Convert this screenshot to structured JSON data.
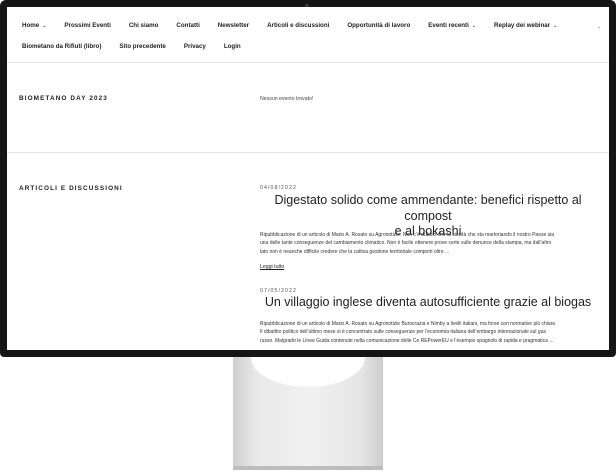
{
  "nav": {
    "row1": [
      {
        "label": "Home",
        "has_dropdown": true
      },
      {
        "label": "Prossimi Eventi",
        "has_dropdown": false
      },
      {
        "label": "Chi siamo",
        "has_dropdown": false
      },
      {
        "label": "Contatti",
        "has_dropdown": false
      },
      {
        "label": "Newsletter",
        "has_dropdown": false
      },
      {
        "label": "Articoli e discussioni",
        "has_dropdown": false
      },
      {
        "label": "Opportunità di lavoro",
        "has_dropdown": false
      },
      {
        "label": "Eventi recenti",
        "has_dropdown": true
      },
      {
        "label": "Replay dei webinar",
        "has_dropdown": true
      }
    ],
    "row2": [
      {
        "label": "Biometano da Rifiuti (libro)"
      },
      {
        "label": "Sito precedente"
      },
      {
        "label": "Privacy"
      },
      {
        "label": "Login"
      }
    ],
    "chevron_glyph": "⌄",
    "overflow_chevron_icon": "chevron-down-icon"
  },
  "event_section": {
    "title": "BIOMETANO DAY 2023",
    "empty_message": "Nessun evento trovato!"
  },
  "articles_section": {
    "title": "ARTICOLI E DISCUSSIONI",
    "posts": [
      {
        "date": "04/08/2022",
        "title_line1": "Digestato solido come ammendante: benefici rispetto al compost",
        "title_line2": "e al bokashi",
        "excerpt_lines": [
          "Ripubblicazione di un articolo di Mario A. Rosato su Agronotizie. Non c’è dubbio che la siccità che sta martoriando il nostro Paese sia",
          "una delle tante conseguenze del cambiamento climatico. Non è facile ottenere prove certe sulle denunce della stampa, ma dall’altro",
          "lato non è neanche difficile credere che la cattiva gestione territoriale comporti oltre ..."
        ],
        "read_more": "Leggi tutto"
      },
      {
        "date": "07/05/2022",
        "title_line1": "Un villaggio inglese diventa autosufficiente grazie al biogas",
        "excerpt_lines": [
          "Ripubblicazione di un articolo di Mario A. Rosato su Agronotizie Burocrazia e Nimby a livelli italiani, ma forse con normative più chiare.",
          "Il dibattito politico dell’ultimo mese si è concentrato sulle conseguenze per l’economia italiana dell’embargo internazionale sul gas",
          "russo. Malgrado le Linee Guida contenute nella comunicazione delle Ce REPowerEU e l’esempio spagnolo di rapida e pragmatica ..."
        ]
      }
    ]
  }
}
